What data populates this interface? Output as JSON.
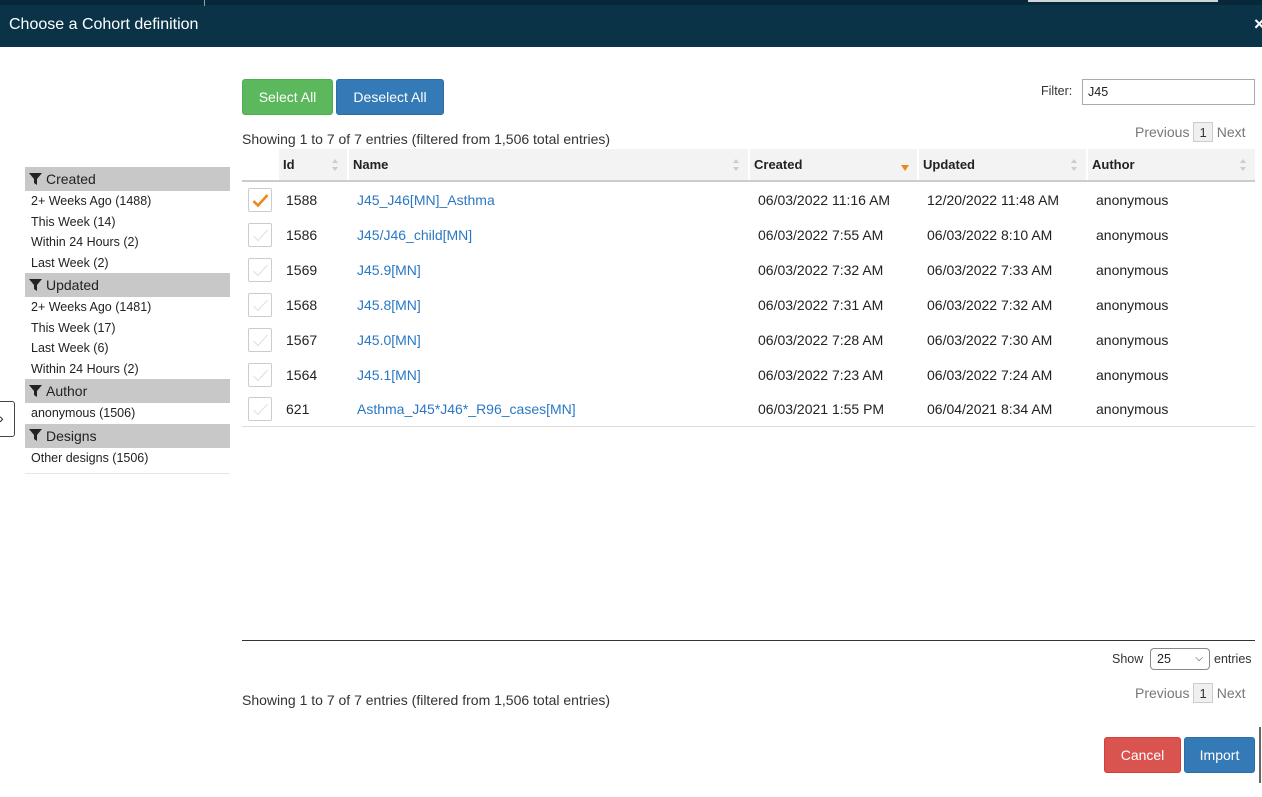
{
  "modal": {
    "title": "Choose a Cohort definition",
    "close_glyph": "×"
  },
  "left_edge_glyph": "›",
  "facets": [
    {
      "title": "Created",
      "items": [
        "2+ Weeks Ago (1488)",
        "This Week (14)",
        "Within 24 Hours (2)",
        "Last Week (2)"
      ]
    },
    {
      "title": "Updated",
      "items": [
        "2+ Weeks Ago (1481)",
        "This Week (17)",
        "Last Week (6)",
        "Within 24 Hours (2)"
      ]
    },
    {
      "title": "Author",
      "items": [
        "anonymous (1506)"
      ]
    },
    {
      "title": "Designs",
      "items": [
        "Other designs (1506)"
      ]
    }
  ],
  "toolbar": {
    "select_all": "Select All",
    "deselect_all": "Deselect All",
    "filter_label": "Filter:",
    "filter_value": "J45"
  },
  "info_text": "Showing 1 to 7 of 7 entries (filtered from 1,506 total entries)",
  "pager": {
    "previous": "Previous",
    "page": "1",
    "next": "Next"
  },
  "table": {
    "columns": [
      "Id",
      "Name",
      "Created",
      "Updated",
      "Author"
    ],
    "sorted_column": "Created",
    "rows": [
      {
        "checked": true,
        "id": "1588",
        "name": "J45_J46[MN]_Asthma",
        "created": "06/03/2022 11:16 AM",
        "updated": "12/20/2022 11:48 AM",
        "author": "anonymous"
      },
      {
        "checked": false,
        "id": "1586",
        "name": "J45/J46_child[MN]",
        "created": "06/03/2022 7:55 AM",
        "updated": "06/03/2022 8:10 AM",
        "author": "anonymous"
      },
      {
        "checked": false,
        "id": "1569",
        "name": "J45.9[MN]",
        "created": "06/03/2022 7:32 AM",
        "updated": "06/03/2022 7:33 AM",
        "author": "anonymous"
      },
      {
        "checked": false,
        "id": "1568",
        "name": "J45.8[MN]",
        "created": "06/03/2022 7:31 AM",
        "updated": "06/03/2022 7:32 AM",
        "author": "anonymous"
      },
      {
        "checked": false,
        "id": "1567",
        "name": "J45.0[MN]",
        "created": "06/03/2022 7:28 AM",
        "updated": "06/03/2022 7:30 AM",
        "author": "anonymous"
      },
      {
        "checked": false,
        "id": "1564",
        "name": "J45.1[MN]",
        "created": "06/03/2022 7:23 AM",
        "updated": "06/03/2022 7:24 AM",
        "author": "anonymous"
      },
      {
        "checked": false,
        "id": "621",
        "name": "Asthma_J45*J46*_R96_cases[MN]",
        "created": "06/03/2021 1:55 PM",
        "updated": "06/04/2021 8:34 AM",
        "author": "anonymous"
      }
    ]
  },
  "length_menu": {
    "show": "Show",
    "value": "25",
    "entries": "entries"
  },
  "footer": {
    "cancel": "Cancel",
    "import": "Import"
  },
  "colors": {
    "header_bg": "#0a3348",
    "select_all": "#5cb85c",
    "primary": "#337ab7",
    "danger": "#d9534f",
    "check": "#f0861e",
    "link": "#2a78c5"
  }
}
